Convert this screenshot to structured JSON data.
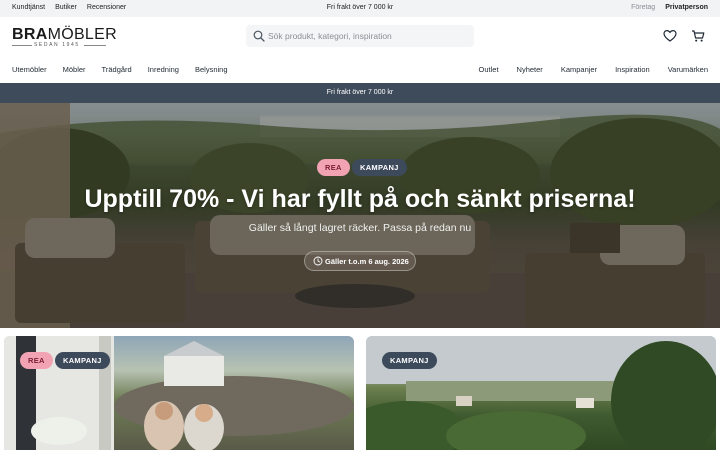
{
  "topbar": {
    "left_links": [
      "Kundtjänst",
      "Butiker",
      "Recensioner"
    ],
    "center_text": "Fri frakt över 7 000 kr",
    "segment": {
      "inactive": "Företag",
      "active": "Privatperson"
    }
  },
  "header": {
    "logo": {
      "brand_bold": "BRA",
      "brand_rest": "MÖBLER",
      "since": "SEDAN 1945"
    },
    "search": {
      "placeholder": "Sök produkt, kategori, inspiration"
    }
  },
  "nav": {
    "left": [
      "Utemöbler",
      "Möbler",
      "Trädgård",
      "Inredning",
      "Belysning"
    ],
    "right": [
      "Outlet",
      "Nyheter",
      "Kampanjer",
      "Inspiration",
      "Varumärken"
    ]
  },
  "shipping_banner": "Fri frakt över 7 000 kr",
  "hero": {
    "badges": [
      "REA",
      "KAMPANJ"
    ],
    "title": "Upptill 70% - Vi har fyllt på och sänkt priserna!",
    "subtitle": "Gäller så långt lagret räcker. Passa på redan nu",
    "date_pill": "Gäller t.o.m 6 aug. 2026"
  },
  "cards": [
    {
      "badges": [
        "REA",
        "KAMPANJ"
      ]
    },
    {
      "badges": [
        "KAMPANJ"
      ]
    }
  ],
  "colors": {
    "shipbar": "#3e4b5a",
    "badge_rea_bg": "#f2a3b3",
    "badge_rea_text": "#7a1c33",
    "badge_kampanj_bg": "#3d4a5c"
  }
}
